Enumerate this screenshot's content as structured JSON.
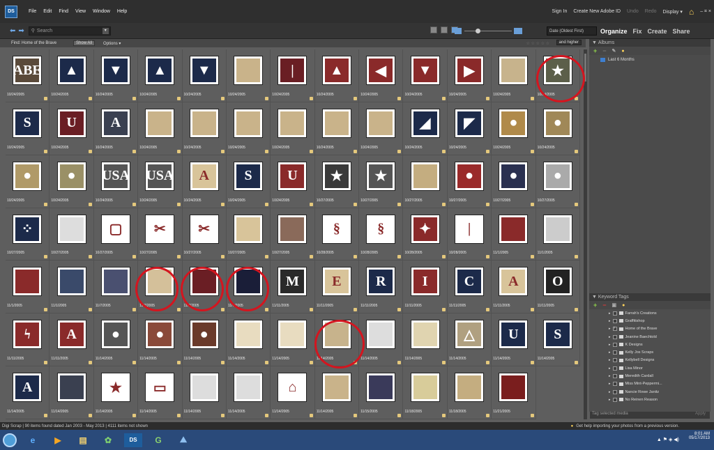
{
  "menubar": {
    "logo": "DS",
    "items": [
      "File",
      "Edit",
      "Find",
      "View",
      "Window",
      "Help"
    ],
    "sign_in": "Sign In",
    "create_id": "Create New Adobe ID",
    "undo": "Undo",
    "redo": "Redo",
    "display": "Display ▾",
    "win_controls": "– ⌗ ×"
  },
  "toolbar": {
    "search_placeholder": "Search",
    "sort_value": "Date (Oldest First)",
    "tabs": [
      "Organize",
      "Fix",
      "Create",
      "Share"
    ]
  },
  "findbar": {
    "label": "Find: Home of the Brave",
    "show_all": "Show All",
    "options": "Options ▾",
    "rating_stars": "☆ ☆ ☆ ☆ ☆",
    "rating_value": "and higher"
  },
  "colors": {
    "ring": "#d4151f",
    "accent_green": "#8fd04a",
    "brand_blue": "#1e5d9c"
  },
  "media": [
    {
      "date": "10/24/2005",
      "c": "#5a4a3a",
      "t": "ABE"
    },
    {
      "date": "10/24/2005",
      "c": "#1c2a4a",
      "t": "▲"
    },
    {
      "date": "10/24/2005",
      "c": "#1c2a4a",
      "t": "▼"
    },
    {
      "date": "10/24/2005",
      "c": "#1c2a4a",
      "t": "▲"
    },
    {
      "date": "10/24/2005",
      "c": "#1c2a4a",
      "t": "▼"
    },
    {
      "date": "10/24/2005",
      "c": "#c9b38a",
      "t": ""
    },
    {
      "date": "10/24/2005",
      "c": "#6a1e24",
      "t": "|"
    },
    {
      "date": "10/24/2005",
      "c": "#8a2a2a",
      "t": "▲"
    },
    {
      "date": "10/24/2005",
      "c": "#8a2a2a",
      "t": "◀"
    },
    {
      "date": "10/24/2005",
      "c": "#8a2a2a",
      "t": "▼"
    },
    {
      "date": "10/24/2005",
      "c": "#8a2a2a",
      "t": "▶"
    },
    {
      "date": "10/24/2005",
      "c": "#c7b38c",
      "t": ""
    },
    {
      "date": "10/24/2005",
      "c": "#5c5f4a",
      "t": "★"
    },
    {
      "date": "10/24/2005",
      "c": "#1c2a4a",
      "t": "S"
    },
    {
      "date": "10/24/2005",
      "c": "#6a1e24",
      "t": "U"
    },
    {
      "date": "10/24/2005",
      "c": "#3a4050",
      "t": "A"
    },
    {
      "date": "10/24/2005",
      "c": "#c9b38a",
      "t": ""
    },
    {
      "date": "10/24/2005",
      "c": "#c9b38a",
      "t": ""
    },
    {
      "date": "10/24/2005",
      "c": "#c9b38a",
      "t": ""
    },
    {
      "date": "10/24/2005",
      "c": "#c9b38a",
      "t": ""
    },
    {
      "date": "10/24/2005",
      "c": "#c9b38a",
      "t": ""
    },
    {
      "date": "10/24/2005",
      "c": "#c9b38a",
      "t": ""
    },
    {
      "date": "10/24/2005",
      "c": "#1c2a4a",
      "t": "◢"
    },
    {
      "date": "10/24/2005",
      "c": "#1c2a4a",
      "t": "◤"
    },
    {
      "date": "10/24/2005",
      "c": "#b08a4a",
      "t": "●"
    },
    {
      "date": "10/24/2005",
      "c": "#a08858",
      "t": "●"
    },
    {
      "date": "10/24/2005",
      "c": "#b09a68",
      "t": "●"
    },
    {
      "date": "10/24/2005",
      "c": "#9a9066",
      "t": "●"
    },
    {
      "date": "10/24/2005",
      "c": "#555",
      "t": "USA"
    },
    {
      "date": "10/24/2005",
      "c": "#555",
      "t": "USA"
    },
    {
      "date": "10/24/2005",
      "c": "#d8c49a",
      "t": "A"
    },
    {
      "date": "10/24/2005",
      "c": "#1c2a4a",
      "t": "S"
    },
    {
      "date": "10/24/2005",
      "c": "#8a2a2a",
      "t": "U"
    },
    {
      "date": "10/27/2005",
      "c": "#3a3a3a",
      "t": "★"
    },
    {
      "date": "10/27/2005",
      "c": "#555",
      "t": "★"
    },
    {
      "date": "10/27/2005",
      "c": "#c4ad80",
      "t": ""
    },
    {
      "date": "10/27/2005",
      "c": "#9a2a2a",
      "t": "●"
    },
    {
      "date": "10/27/2005",
      "c": "#2a3050",
      "t": "●"
    },
    {
      "date": "10/27/2005",
      "c": "#aaa",
      "t": "●"
    },
    {
      "date": "10/27/2005",
      "c": "#1c2a4a",
      "t": "⁘"
    },
    {
      "date": "10/27/2005",
      "c": "#ddd",
      "t": ""
    },
    {
      "date": "10/27/2005",
      "c": "#fff",
      "t": "▢"
    },
    {
      "date": "10/27/2005",
      "c": "#fff",
      "t": "✂"
    },
    {
      "date": "10/27/2005",
      "c": "#fff",
      "t": "✂"
    },
    {
      "date": "10/27/2005",
      "c": "#d8c49a",
      "t": ""
    },
    {
      "date": "10/27/2005",
      "c": "#8a6a5a",
      "t": ""
    },
    {
      "date": "10/28/2005",
      "c": "#fff",
      "t": "§"
    },
    {
      "date": "10/28/2005",
      "c": "#fff",
      "t": "§"
    },
    {
      "date": "10/28/2005",
      "c": "#8a2a2a",
      "t": "✦"
    },
    {
      "date": "10/28/2005",
      "c": "#fff",
      "t": "|"
    },
    {
      "date": "11/1/2005",
      "c": "#8a2a2a",
      "t": ""
    },
    {
      "date": "11/1/2005",
      "c": "#ccc",
      "t": ""
    },
    {
      "date": "11/1/2005",
      "c": "#8a2a2a",
      "t": ""
    },
    {
      "date": "11/1/2005",
      "c": "#3a4a6a",
      "t": ""
    },
    {
      "date": "11/7/2005",
      "c": "#4a5070",
      "t": ""
    },
    {
      "date": "11/7/2005",
      "c": "#d4c09a",
      "t": ""
    },
    {
      "date": "11/7/2005",
      "c": "#6a1e24",
      "t": ""
    },
    {
      "date": "11/7/2005",
      "c": "#1a1e38",
      "t": ""
    },
    {
      "date": "11/11/2005",
      "c": "#2a2a2a",
      "t": "M"
    },
    {
      "date": "11/11/2005",
      "c": "#d8c49a",
      "t": "E"
    },
    {
      "date": "11/11/2005",
      "c": "#1c2a4a",
      "t": "R"
    },
    {
      "date": "11/11/2005",
      "c": "#8a2a2a",
      "t": "I"
    },
    {
      "date": "11/11/2005",
      "c": "#1c2a4a",
      "t": "C"
    },
    {
      "date": "11/11/2005",
      "c": "#d8c49a",
      "t": "A"
    },
    {
      "date": "11/11/2005",
      "c": "#222",
      "t": "O"
    },
    {
      "date": "11/11/2005",
      "c": "#8a2a2a",
      "t": "ϟ"
    },
    {
      "date": "11/11/2005",
      "c": "#8a2a2a",
      "t": "A"
    },
    {
      "date": "11/14/2005",
      "c": "#555",
      "t": "●"
    },
    {
      "date": "11/14/2005",
      "c": "#8a4a3a",
      "t": "●"
    },
    {
      "date": "11/14/2005",
      "c": "#6a3a2a",
      "t": "●"
    },
    {
      "date": "11/14/2005",
      "c": "#e8dcc0",
      "t": ""
    },
    {
      "date": "11/14/2005",
      "c": "#e8dcc0",
      "t": ""
    },
    {
      "date": "11/14/2005",
      "c": "#c7b38c",
      "t": ""
    },
    {
      "date": "11/14/2005",
      "c": "#ddd",
      "t": ""
    },
    {
      "date": "11/14/2005",
      "c": "#e0d4b0",
      "t": ""
    },
    {
      "date": "11/14/2005",
      "c": "#b0a080",
      "t": "△"
    },
    {
      "date": "11/14/2005",
      "c": "#1c2a4a",
      "t": "U"
    },
    {
      "date": "11/14/2005",
      "c": "#1c2a4a",
      "t": "S"
    },
    {
      "date": "11/14/2005",
      "c": "#1c2a4a",
      "t": "A"
    },
    {
      "date": "11/14/2005",
      "c": "#3a4050",
      "t": ""
    },
    {
      "date": "11/14/2005",
      "c": "#fff",
      "t": "★"
    },
    {
      "date": "11/14/2005",
      "c": "#fff",
      "t": "▭"
    },
    {
      "date": "11/14/2005",
      "c": "#ddd",
      "t": ""
    },
    {
      "date": "11/14/2005",
      "c": "#ddd",
      "t": ""
    },
    {
      "date": "11/14/2005",
      "c": "#fff",
      "t": "⌂"
    },
    {
      "date": "11/14/2005",
      "c": "#c9b38a",
      "t": ""
    },
    {
      "date": "11/15/2005",
      "c": "#3a3a5a",
      "t": ""
    },
    {
      "date": "11/18/2005",
      "c": "#d8cc9a",
      "t": ""
    },
    {
      "date": "11/18/2005",
      "c": "#c4ad80",
      "t": ""
    },
    {
      "date": "11/21/2005",
      "c": "#7a1e1e",
      "t": ""
    }
  ],
  "albums": {
    "header": "Albums",
    "items": [
      "Last 6 Months"
    ]
  },
  "keywords": {
    "header": "Keyword Tags",
    "items": [
      "Farrah's Creations",
      "Graffitishop",
      "Home of the Brave",
      "Jeanine Baechtold",
      "K Designs",
      "Kelly Jos Scraps",
      "Kellybell Designs",
      "Lisa Minor",
      "Meredith Cardall",
      "Miss Mint-Peppermi...",
      "Nancie Rowe Janitz",
      "No Reinen Reason"
    ],
    "tag_media": "Tag selected media",
    "apply": "Apply"
  },
  "status": {
    "text": "Digi Scrap | 90 items found dated Jan 2003 - May 2013 | 4111 items not shown",
    "help": "Get help importing your photos from a previous version."
  },
  "taskbar": {
    "time": "8:01 AM",
    "date": "05/17/2013"
  }
}
